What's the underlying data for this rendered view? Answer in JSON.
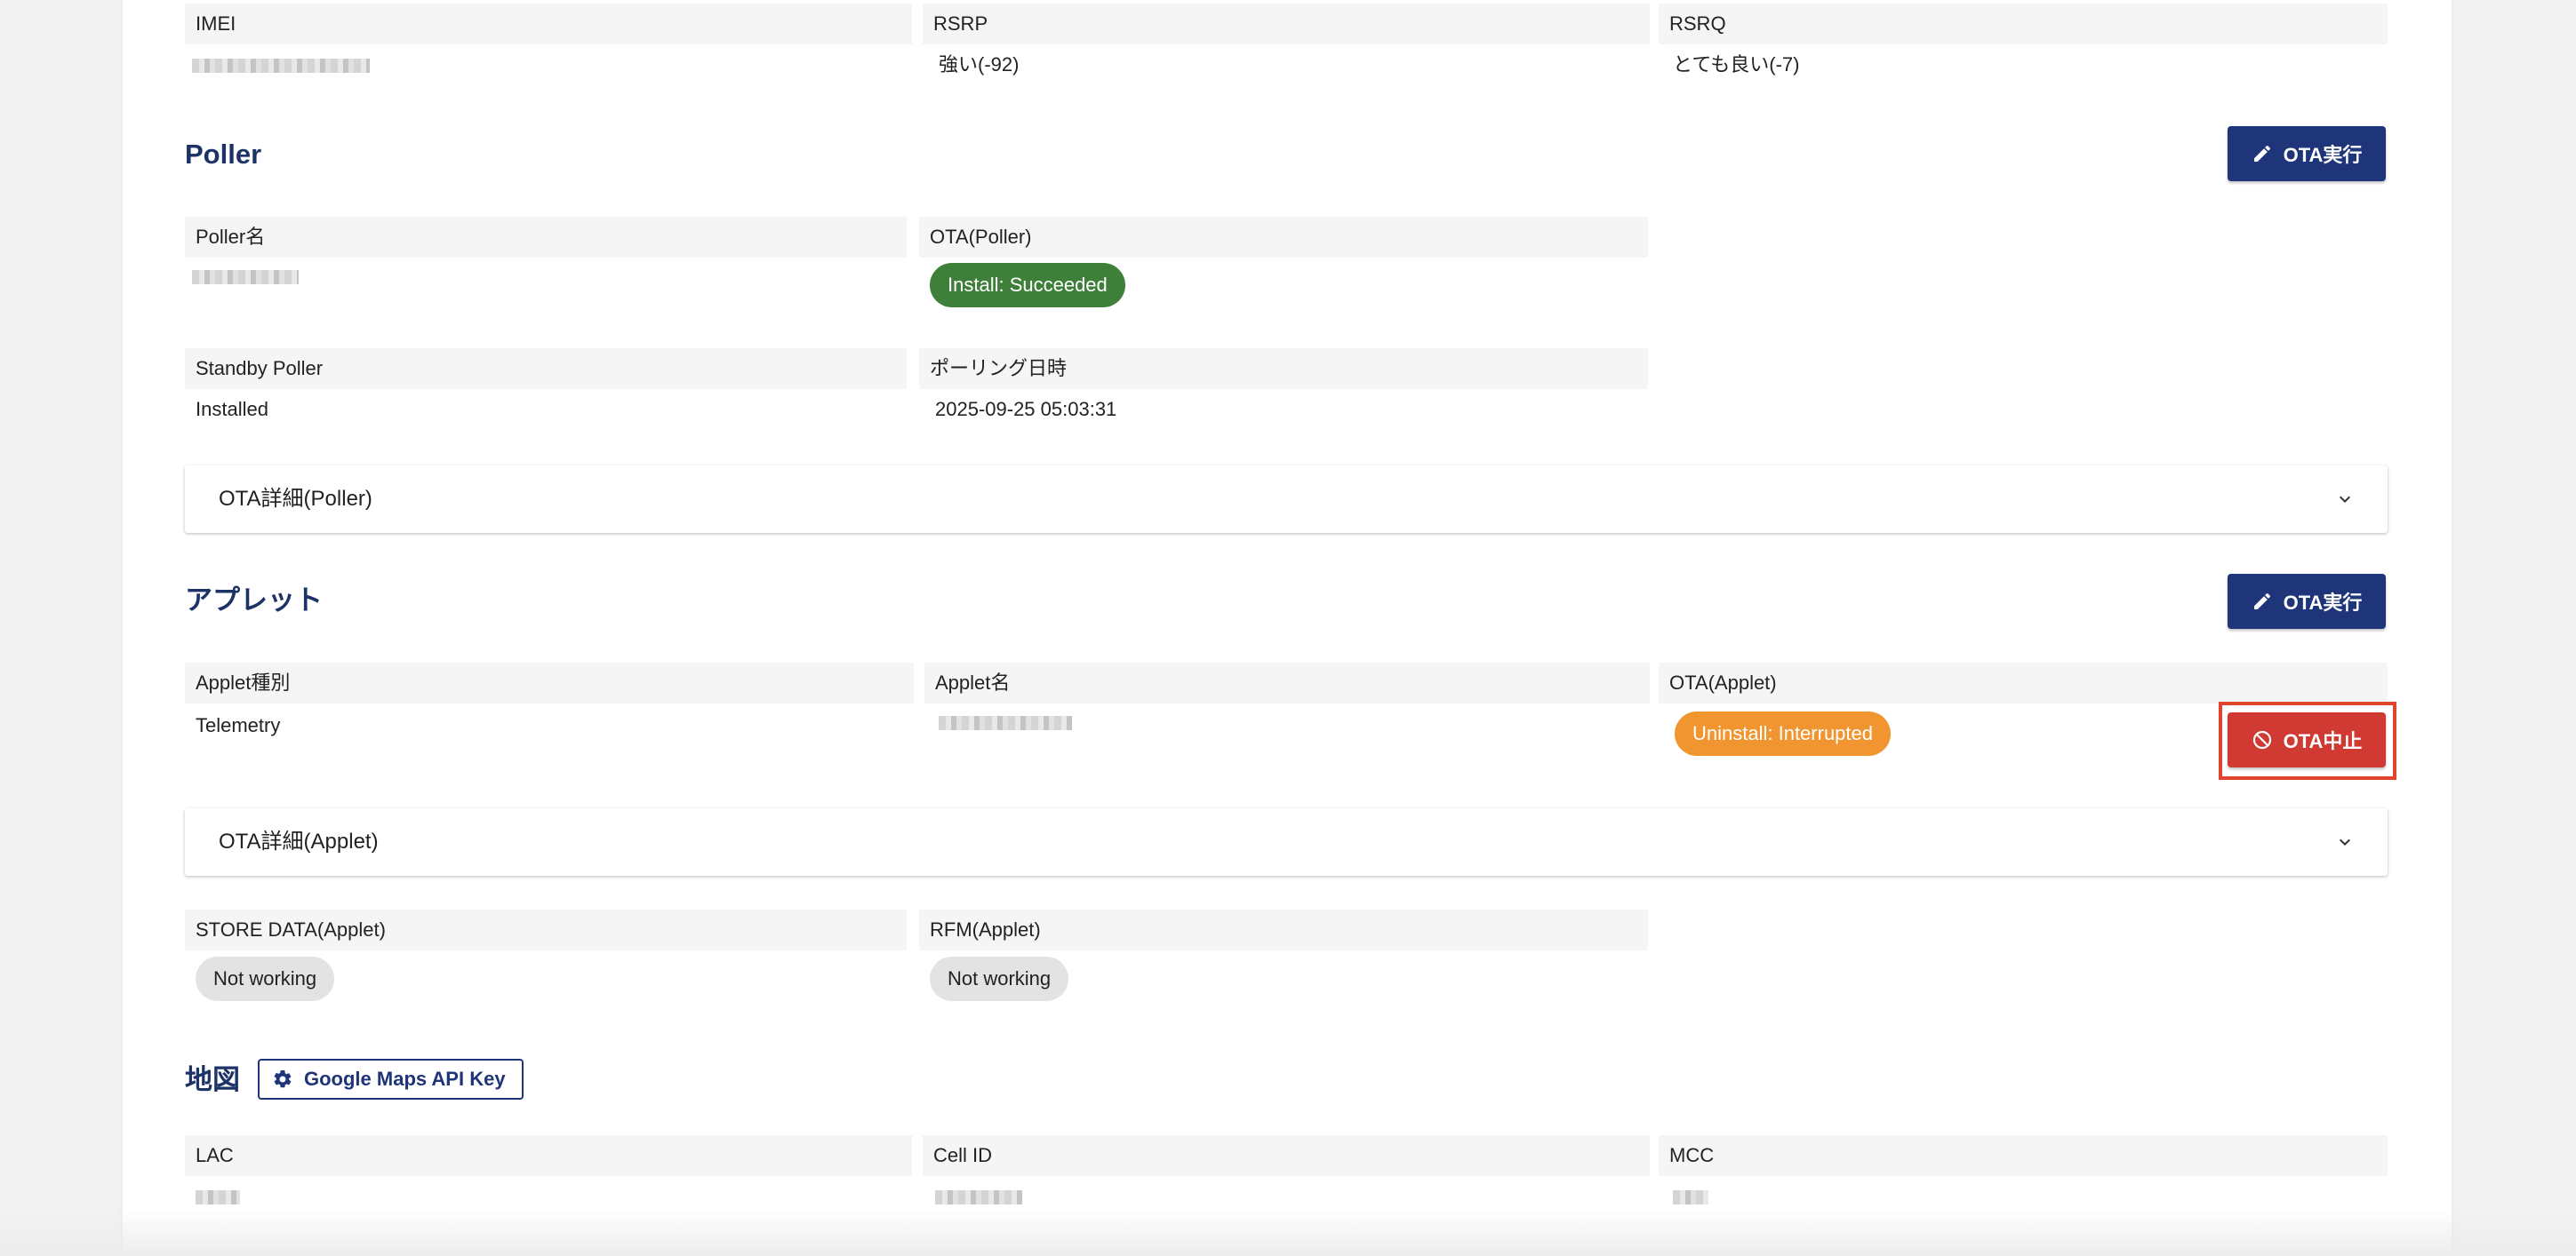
{
  "network": {
    "imei_label": "IMEI",
    "rsrp_label": "RSRP",
    "rsrp_value": "強い(-92)",
    "rsrq_label": "RSRQ",
    "rsrq_value": "とても良い(-7)"
  },
  "poller": {
    "title": "Poller",
    "ota_button": "OTA実行",
    "name_label": "Poller名",
    "ota_label": "OTA(Poller)",
    "ota_status": "Install: Succeeded",
    "standby_label": "Standby Poller",
    "standby_value": "Installed",
    "polling_label": "ポーリング日時",
    "polling_value": "2025-09-25 05:03:31",
    "details_title": "OTA詳細(Poller)"
  },
  "applet": {
    "title": "アプレット",
    "ota_button": "OTA実行",
    "type_label": "Applet種別",
    "type_value": "Telemetry",
    "name_label": "Applet名",
    "ota_label": "OTA(Applet)",
    "ota_status": "Uninstall: Interrupted",
    "stop_button": "OTA中止",
    "details_title": "OTA詳細(Applet)",
    "store_label": "STORE DATA(Applet)",
    "store_status": "Not working",
    "rfm_label": "RFM(Applet)",
    "rfm_status": "Not working"
  },
  "map": {
    "title": "地図",
    "api_key_button": "Google Maps API Key",
    "lac_label": "LAC",
    "cellid_label": "Cell ID",
    "mcc_label": "MCC"
  },
  "colors": {
    "primary": "#1f3579",
    "danger": "#d03a33",
    "success": "#3e7f3a",
    "warning": "#f0952f",
    "neutral_chip": "#e3e3e3",
    "title": "#1d3266"
  },
  "icons": {
    "edit": "pencil-icon",
    "stop": "block-icon",
    "expand": "chevron-down-icon",
    "settings": "gear-icon"
  }
}
